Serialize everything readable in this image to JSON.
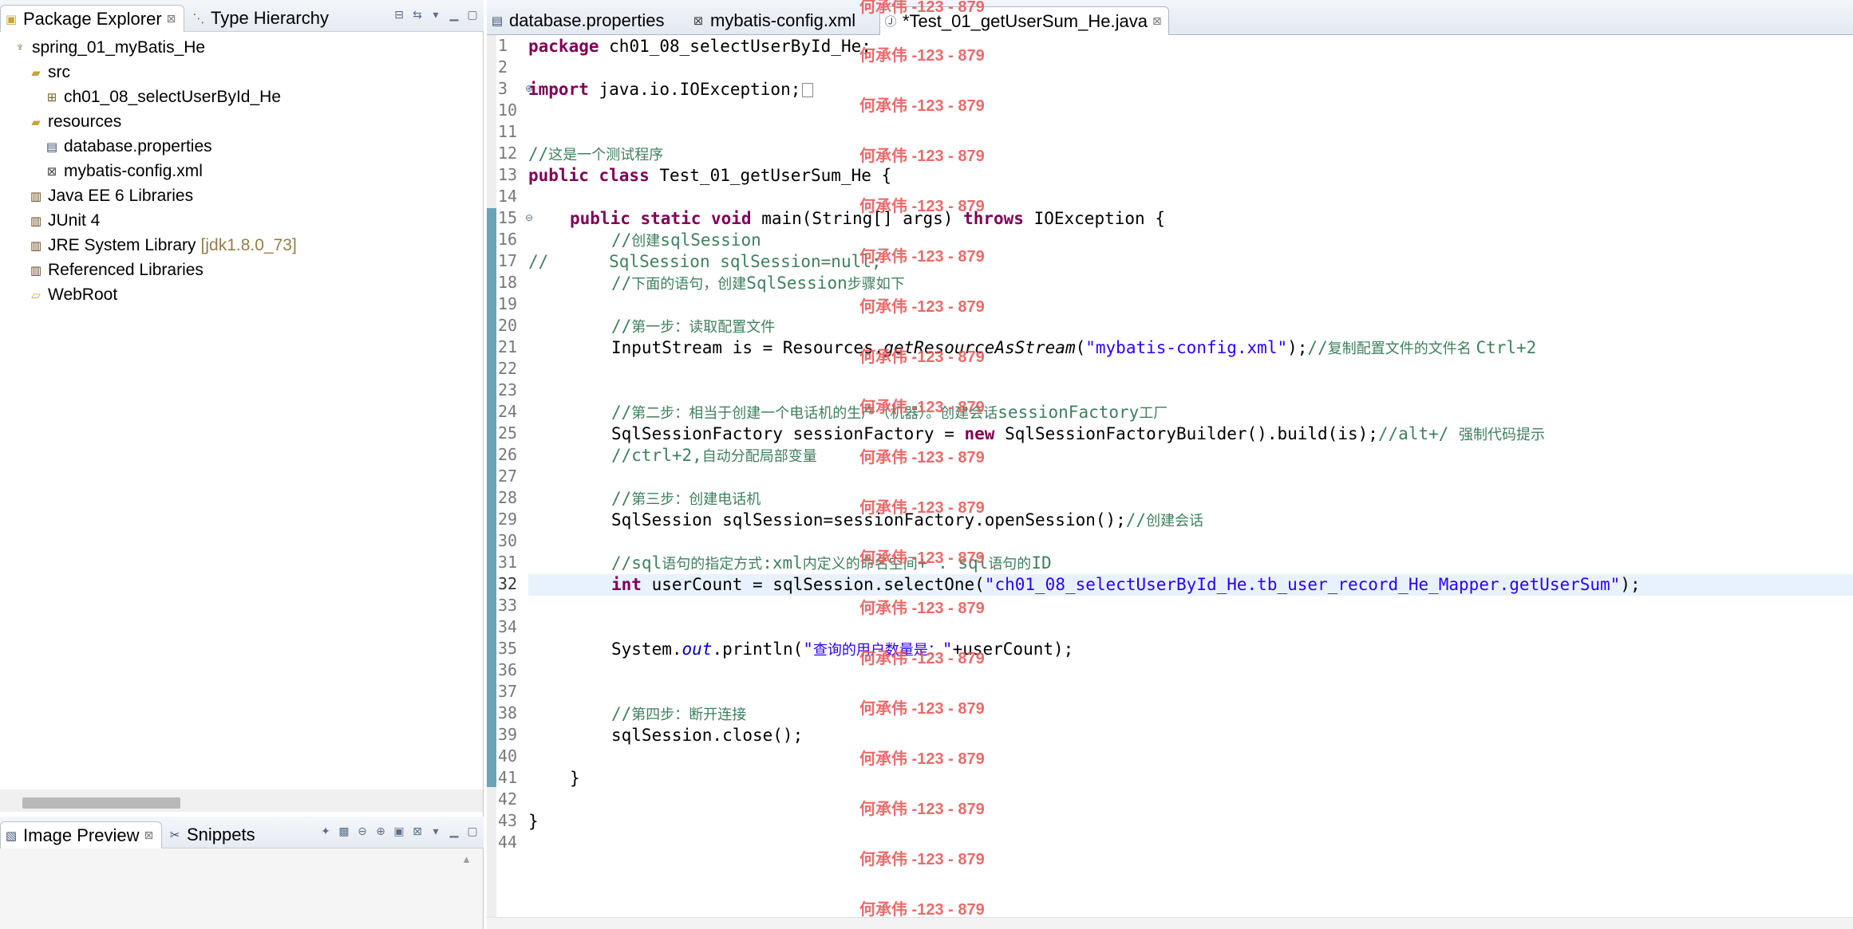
{
  "package_explorer": {
    "tabs": [
      {
        "label": "Package Explorer",
        "close": "⊠"
      },
      {
        "label": "Type Hierarchy"
      }
    ],
    "tree": [
      {
        "label": "spring_01_myBatis_He",
        "icon": "project-icon",
        "level": 0
      },
      {
        "label": "src",
        "icon": "source-folder-icon",
        "level": 1
      },
      {
        "label": "ch01_08_selectUserById_He",
        "icon": "package-icon",
        "level": 2
      },
      {
        "label": "resources",
        "icon": "source-folder-icon",
        "level": 1
      },
      {
        "label": "database.properties",
        "icon": "properties-file-icon",
        "level": 2
      },
      {
        "label": "mybatis-config.xml",
        "icon": "xml-file-icon",
        "level": 2
      },
      {
        "label": "Java EE 6 Libraries",
        "icon": "library-icon",
        "level": 1
      },
      {
        "label": "JUnit 4",
        "icon": "library-icon",
        "level": 1
      },
      {
        "label": "JRE System Library",
        "decoration": "[jdk1.8.0_73]",
        "icon": "library-icon",
        "level": 1
      },
      {
        "label": "Referenced Libraries",
        "icon": "library-icon",
        "level": 1
      },
      {
        "label": "WebRoot",
        "icon": "folder-icon",
        "level": 1
      }
    ]
  },
  "bottom_views": {
    "tabs": [
      {
        "label": "Image Preview",
        "close": "⊠"
      },
      {
        "label": "Snippets"
      }
    ]
  },
  "editor": {
    "tabs": [
      {
        "label": "database.properties"
      },
      {
        "label": "mybatis-config.xml"
      },
      {
        "label": "*Test_01_getUserSum_He.java",
        "close": "⊠",
        "active": true
      }
    ],
    "line_numbers": [
      "1",
      "2",
      "3",
      "10",
      "11",
      "12",
      "13",
      "14",
      "15",
      "16",
      "17",
      "18",
      "19",
      "20",
      "21",
      "22",
      "23",
      "24",
      "25",
      "26",
      "27",
      "28",
      "29",
      "30",
      "31",
      "32",
      "33",
      "34",
      "35",
      "36",
      "37",
      "38",
      "39",
      "40",
      "41",
      "42",
      "43",
      "44"
    ],
    "current_line": "32",
    "watermark": "何承伟 -123 - 879",
    "code": {
      "l1_kw": "package",
      "l1_rest": " ch01_08_selectUserById_He;",
      "l3_kw": "import",
      "l3_rest": " java.io.IOException;",
      "l12_a": "//",
      "l12_b": "这是一个测试程序",
      "l13_kw": "public class",
      "l13_rest": " Test_01_getUserSum_He {",
      "l15_kw": "public static void",
      "l15_mid": " main(String[] args) ",
      "l15_kw2": "throws",
      "l15_rest": " IOException {",
      "l16_a": "//",
      "l16_b": "创建",
      "l16_c": "sqlSession",
      "l17_a": "//",
      "l17_b": "SqlSession sqlSession=null;",
      "l18_a": "//",
      "l18_b": "下面的语句，创建",
      "l18_c": "SqlSession",
      "l18_d": "步骤如下",
      "l20_a": "//",
      "l20_b": "第一步：读取配置文件",
      "l21_a": "InputStream is = Resources.",
      "l21_b": "getResourceAsStream",
      "l21_c": "(",
      "l21_d": "\"mybatis-config.xml\"",
      "l21_e": ");",
      "l21_f": "//",
      "l21_g": "复制配置文件的文件名 ",
      "l21_h": "Ctrl+2",
      "l24_a": "//",
      "l24_b": "第二步：相当于创建一个电话机的生产（机器）。创建会话",
      "l24_c": "sessionFactory",
      "l24_d": "工厂",
      "l25_a": "SqlSessionFactory sessionFactory = ",
      "l25_kw": "new",
      "l25_b": " SqlSessionFactoryBuilder().build(is);",
      "l25_c": "//alt+/ ",
      "l25_d": "强制代码提示",
      "l26_a": "//ctrl+2,",
      "l26_b": "自动分配局部变量",
      "l28_a": "//",
      "l28_b": "第三步：创建电话机",
      "l29_a": "SqlSession sqlSession=sessionFactory.openSession();",
      "l29_b": "//",
      "l29_c": "创建会话",
      "l31_a": "//sql",
      "l31_b": "语句的指定方式",
      "l31_c": ":xml",
      "l31_d": "内定义的命名空间",
      "l31_e": "+ . sql",
      "l31_f": "语句的",
      "l31_g": "ID",
      "l32_kw": "int",
      "l32_a": " userCount = sqlSession.selectOne(",
      "l32_str": "\"ch01_08_selectUserById_He.tb_user_record_He_Mapper.getUserSum\"",
      "l32_b": ");",
      "l35_a": "System.",
      "l35_field": "out",
      "l35_b": ".println(",
      "l35_c": "\"",
      "l35_d": "查询的用户数量是：",
      "l35_e": "\"",
      "l35_f": "+userCount);",
      "l38_a": "//",
      "l38_b": "第四步：断开连接",
      "l39_a": "sqlSession.close();",
      "l41_a": "}",
      "l43_a": "}"
    }
  },
  "colors": {
    "keyword": "#7f0055",
    "comment": "#3f7f5f",
    "string": "#2a00ff",
    "ruler_highlight": "#6aa4b6",
    "current_line": "#e8f2fe",
    "watermark": "#e85b5b"
  }
}
